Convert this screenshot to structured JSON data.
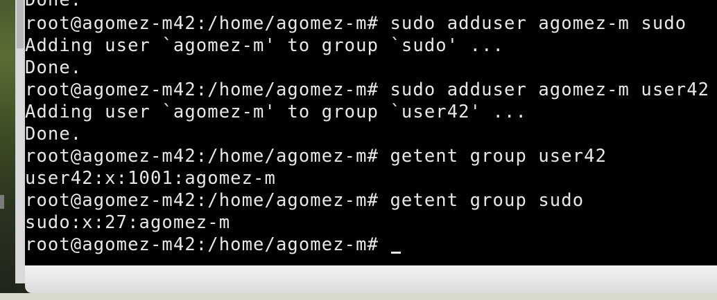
{
  "terminal": {
    "lines": [
      "Done.",
      "root@agomez-m42:/home/agomez-m# sudo adduser agomez-m sudo",
      "Adding user `agomez-m' to group `sudo' ...",
      "Done.",
      "root@agomez-m42:/home/agomez-m# sudo adduser agomez-m user42",
      "Adding user `agomez-m' to group `user42' ...",
      "Done.",
      "root@agomez-m42:/home/agomez-m# getent group user42",
      "user42:x:1001:agomez-m",
      "root@agomez-m42:/home/agomez-m# getent group sudo",
      "sudo:x:27:agomez-m",
      "root@agomez-m42:/home/agomez-m# "
    ],
    "text_color": "#e8e8e8",
    "background": "#000000"
  }
}
